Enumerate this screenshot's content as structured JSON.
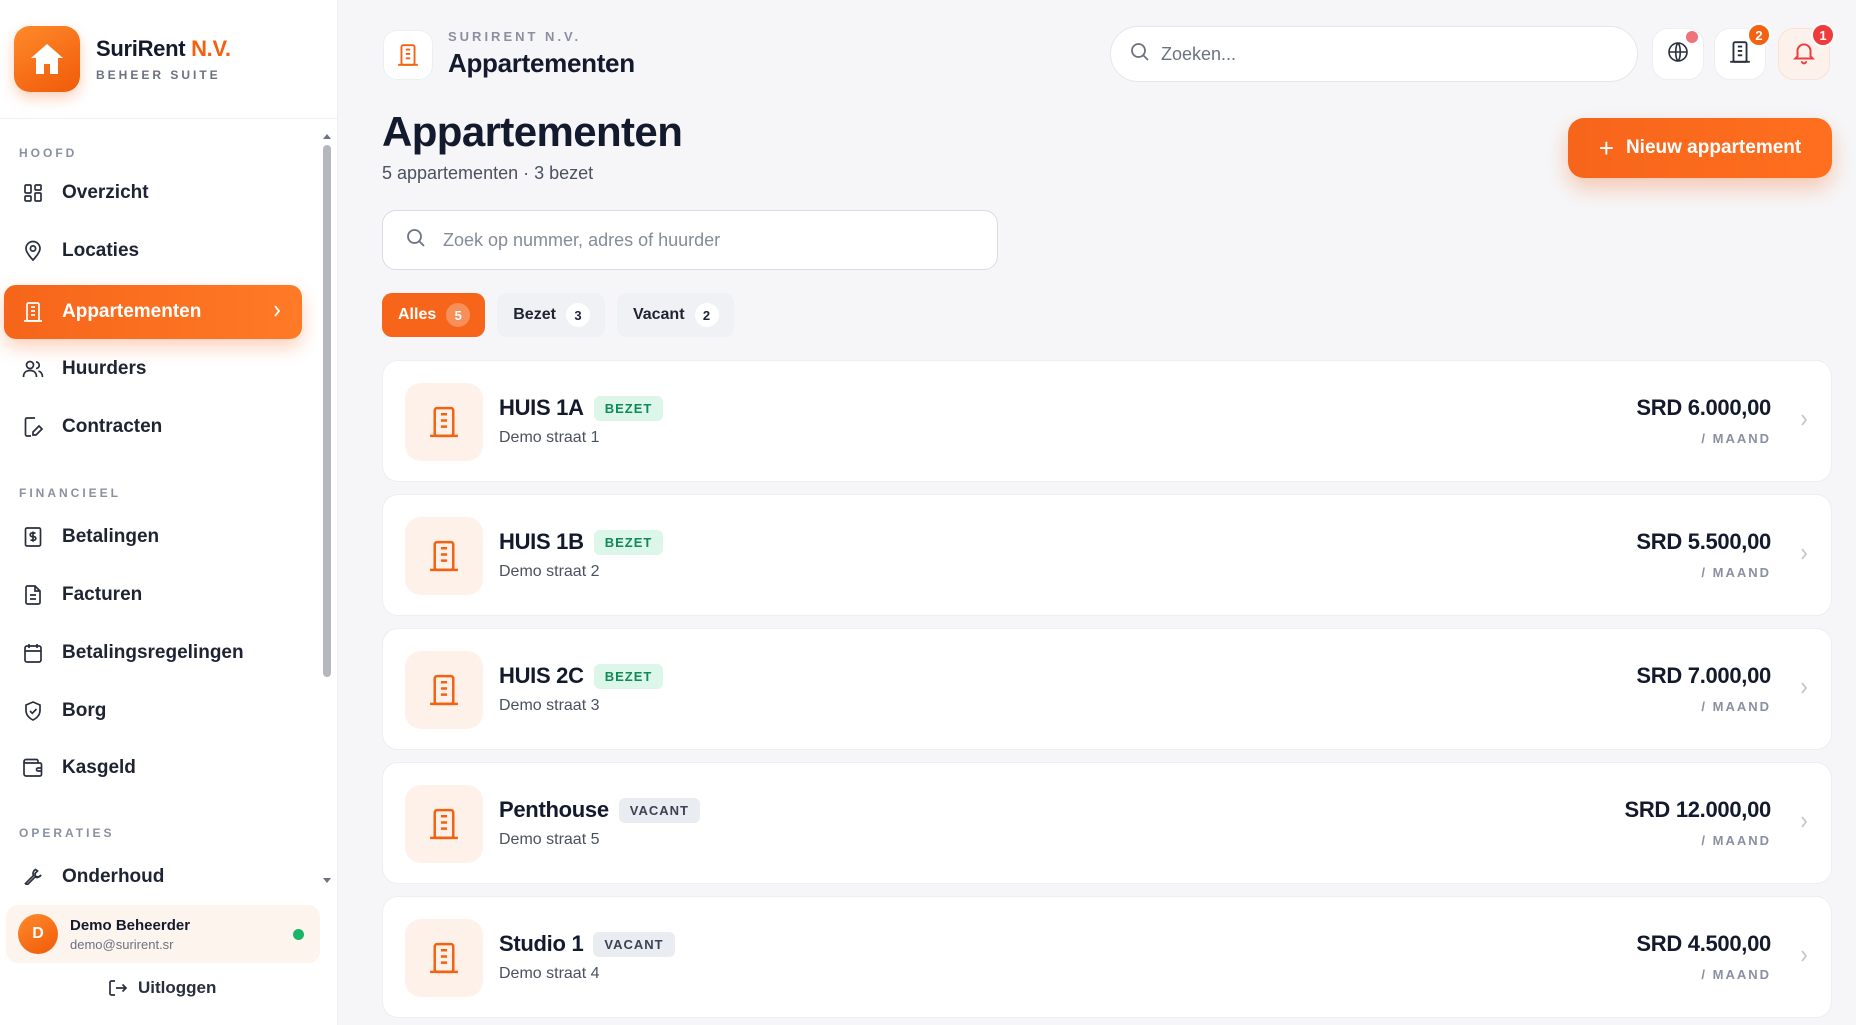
{
  "brand": {
    "name": "SuriRent",
    "name_accent": "N.V.",
    "subtitle": "BEHEER SUITE",
    "icon": "home-icon"
  },
  "sidebar": {
    "sections": [
      {
        "label": "HOOFD"
      },
      {
        "label": "FINANCIEEL"
      },
      {
        "label": "OPERATIES"
      }
    ],
    "items": [
      {
        "label": "Overzicht",
        "icon": "dashboard-icon"
      },
      {
        "label": "Locaties",
        "icon": "map-pin-icon"
      },
      {
        "label": "Appartementen",
        "icon": "building-icon",
        "active": true
      },
      {
        "label": "Huurders",
        "icon": "users-icon"
      },
      {
        "label": "Contracten",
        "icon": "contract-edit-icon"
      },
      {
        "label": "Betalingen",
        "icon": "dollar-receipt-icon"
      },
      {
        "label": "Facturen",
        "icon": "invoice-icon"
      },
      {
        "label": "Betalingsregelingen",
        "icon": "calendar-icon"
      },
      {
        "label": "Borg",
        "icon": "shield-icon"
      },
      {
        "label": "Kasgeld",
        "icon": "wallet-icon"
      },
      {
        "label": "Onderhoud",
        "icon": "wrench-icon"
      }
    ]
  },
  "user": {
    "initial": "D",
    "name": "Demo Beheerder",
    "email": "demo@surirent.sr",
    "status": "online"
  },
  "logout_label": "Uitloggen",
  "header": {
    "crumb": "SURIRENT N.V.",
    "title": "Appartementen",
    "search_placeholder": "Zoeken...",
    "buildings_badge": "2",
    "notifications_badge": "1"
  },
  "page": {
    "title": "Appartementen",
    "subtitle": "5 appartementen · 3 bezet",
    "new_button": "Nieuw appartement",
    "search_placeholder": "Zoek op nummer, adres of huurder"
  },
  "filters": [
    {
      "label": "Alles",
      "count": "5",
      "active": true
    },
    {
      "label": "Bezet",
      "count": "3"
    },
    {
      "label": "Vacant",
      "count": "2"
    }
  ],
  "apartments": [
    {
      "name": "HUIS 1A",
      "status": "BEZET",
      "address": "Demo straat 1",
      "price": "SRD 6.000,00",
      "period": "/ MAAND"
    },
    {
      "name": "HUIS 1B",
      "status": "BEZET",
      "address": "Demo straat 2",
      "price": "SRD 5.500,00",
      "period": "/ MAAND"
    },
    {
      "name": "HUIS 2C",
      "status": "BEZET",
      "address": "Demo straat 3",
      "price": "SRD 7.000,00",
      "period": "/ MAAND"
    },
    {
      "name": "Penthouse",
      "status": "VACANT",
      "address": "Demo straat 5",
      "price": "SRD 12.000,00",
      "period": "/ MAAND"
    },
    {
      "name": "Studio 1",
      "status": "VACANT",
      "address": "Demo straat 4",
      "price": "SRD 4.500,00",
      "period": "/ MAAND"
    }
  ],
  "colors": {
    "accent": "#f6651a",
    "bezet_bg": "#dcf6e9",
    "bezet_text": "#108a56",
    "vacant_bg": "#e9ecf1",
    "online": "#1bb56a"
  }
}
